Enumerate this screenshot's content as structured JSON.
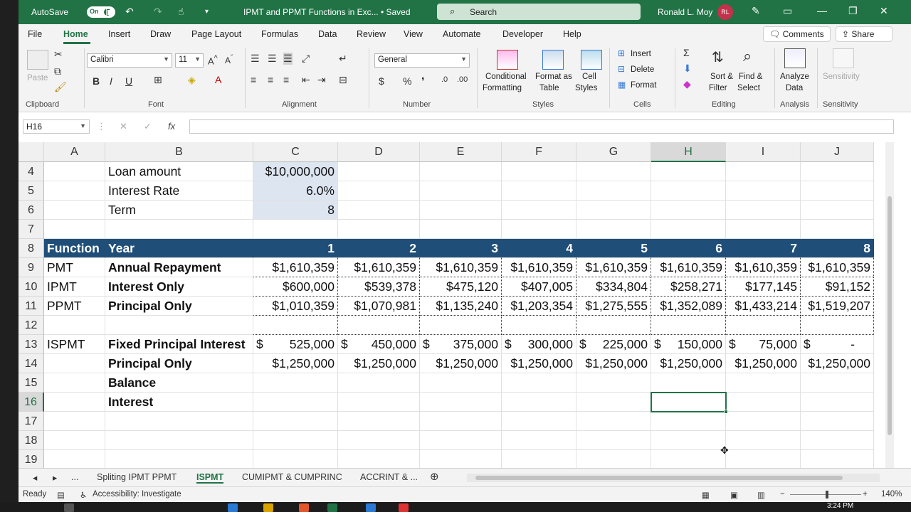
{
  "title_bar": {
    "autosave_label": "AutoSave",
    "autosave_state": "On",
    "document_title": "IPMT and PPMT Functions in Exc... • Saved",
    "search_placeholder": "Search",
    "user_name": "Ronald L. Moy",
    "user_initials": "RL"
  },
  "menu": {
    "tabs": [
      "File",
      "Home",
      "Insert",
      "Draw",
      "Page Layout",
      "Formulas",
      "Data",
      "Review",
      "View",
      "Automate",
      "Developer",
      "Help"
    ],
    "active_tab": "Home",
    "comments_label": "Comments",
    "share_label": "Share"
  },
  "ribbon": {
    "clipboard": {
      "paste_label": "Paste",
      "group_label": "Clipboard"
    },
    "font": {
      "font_name": "Calibri",
      "font_size": "11",
      "group_label": "Font",
      "bold": "B",
      "italic": "I",
      "underline": "U"
    },
    "alignment": {
      "group_label": "Alignment"
    },
    "number": {
      "format": "General",
      "group_label": "Number"
    },
    "styles": {
      "conditional_formatting": [
        "Conditional",
        "Formatting"
      ],
      "format_as_table": [
        "Format as",
        "Table"
      ],
      "cell_styles": [
        "Cell",
        "Styles"
      ],
      "group_label": "Styles"
    },
    "cells": {
      "insert": "Insert",
      "delete": "Delete",
      "format": "Format",
      "group_label": "Cells"
    },
    "editing": {
      "sort_filter": [
        "Sort &",
        "Filter"
      ],
      "find_select": [
        "Find &",
        "Select"
      ],
      "group_label": "Editing"
    },
    "analysis": {
      "analyze_data": [
        "Analyze",
        "Data"
      ],
      "group_label": "Analysis"
    },
    "sensitivity": {
      "label": "Sensitivity",
      "group_label": "Sensitivity"
    }
  },
  "formula_bar": {
    "name_box": "H16",
    "formula": ""
  },
  "sheet": {
    "columns": [
      "A",
      "B",
      "C",
      "D",
      "E",
      "F",
      "G",
      "H",
      "I",
      "J"
    ],
    "selected_column": "H",
    "rows": [
      "4",
      "5",
      "6",
      "7",
      "8",
      "9",
      "10",
      "11",
      "12",
      "13",
      "14",
      "15",
      "16",
      "17",
      "18",
      "19"
    ],
    "selected_row": "16",
    "selected_cell": "H16",
    "inputs": [
      {
        "label": "Loan amount",
        "value": "$10,000,000"
      },
      {
        "label": "Interest Rate",
        "value": "6.0%"
      },
      {
        "label": "Term",
        "value": "8"
      }
    ],
    "table_header": {
      "function": "Function",
      "year": "Year",
      "years": [
        "1",
        "2",
        "3",
        "4",
        "5",
        "6",
        "7",
        "8"
      ]
    },
    "rows_data": [
      {
        "function": "PMT",
        "label": "Annual Repayment",
        "values": [
          "$1,610,359",
          "$1,610,359",
          "$1,610,359",
          "$1,610,359",
          "$1,610,359",
          "$1,610,359",
          "$1,610,359",
          "$1,610,359"
        ]
      },
      {
        "function": "IPMT",
        "label": "Interest Only",
        "values": [
          "$600,000",
          "$539,378",
          "$475,120",
          "$407,005",
          "$334,804",
          "$258,271",
          "$177,145",
          "$91,152"
        ]
      },
      {
        "function": "PPMT",
        "label": "Principal Only",
        "values": [
          "$1,010,359",
          "$1,070,981",
          "$1,135,240",
          "$1,203,354",
          "$1,275,555",
          "$1,352,089",
          "$1,433,214",
          "$1,519,207"
        ]
      }
    ],
    "ispmt": {
      "function": "ISPMT",
      "fixed_label": "Fixed Principal Interest",
      "fixed_values": [
        [
          "$",
          "525,000"
        ],
        [
          "$",
          "450,000"
        ],
        [
          "$",
          "375,000"
        ],
        [
          "$",
          "300,000"
        ],
        [
          "$",
          "225,000"
        ],
        [
          "$",
          "150,000"
        ],
        [
          "$",
          "75,000"
        ],
        [
          "$",
          "-"
        ]
      ],
      "principal_label": "Principal Only",
      "principal_values": [
        "$1,250,000",
        "$1,250,000",
        "$1,250,000",
        "$1,250,000",
        "$1,250,000",
        "$1,250,000",
        "$1,250,000",
        "$1,250,000"
      ],
      "balance_label": "Balance",
      "interest_label": "Interest"
    }
  },
  "sheet_tabs": {
    "tabs": [
      "Spliting IPMT PPMT",
      "ISPMT",
      "CUMIPMT & CUMPRINC",
      "ACCRINT & ..."
    ],
    "active": "ISPMT",
    "more": "..."
  },
  "status_bar": {
    "ready": "Ready",
    "accessibility": "Accessibility: Investigate",
    "zoom": "140%"
  },
  "taskbar": {
    "time": "3:24 PM"
  }
}
